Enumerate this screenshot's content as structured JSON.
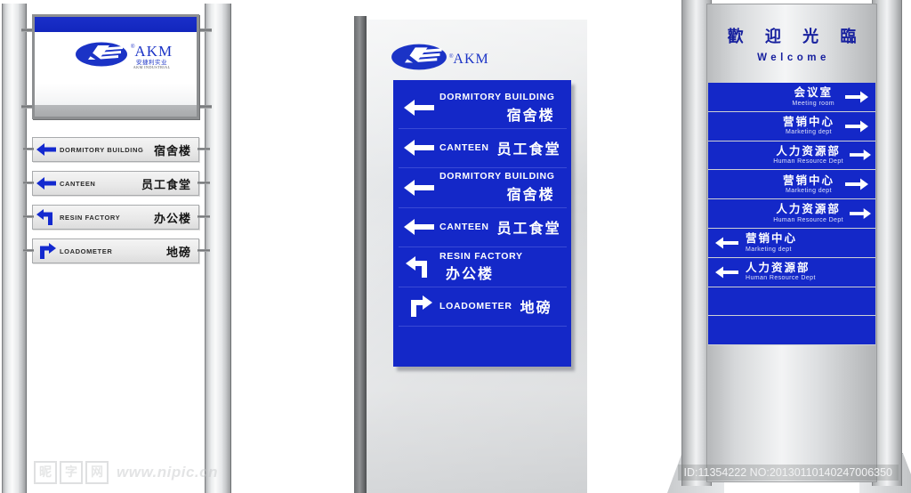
{
  "colors": {
    "sign_blue": "#1428c8",
    "logo_blue": "#1b33c6",
    "welcome_blue": "#17209e",
    "plate_grey": "#e9e9e9",
    "metal_light": "#f3f4f5"
  },
  "brand": {
    "name": "AKM",
    "registered": "®",
    "cn_name": "安捷利实业",
    "en_sub": "AKM INDUSTRIAL"
  },
  "left_pylon": {
    "name": "Left pylon sign with header billboard",
    "billboard": {
      "logo_name": "AKM"
    },
    "plates": [
      {
        "arrow": "arrow-left-icon",
        "en": "DORMITORY BUILDING",
        "cn": "宿舍楼"
      },
      {
        "arrow": "arrow-left-icon",
        "en": "CANTEEN",
        "cn": "员工食堂"
      },
      {
        "arrow": "arrow-left-up-icon",
        "en": "RESIN FACTORY",
        "cn": "办公楼"
      },
      {
        "arrow": "arrow-right-up-icon",
        "en": "LOADOMETER",
        "cn": "地磅"
      }
    ]
  },
  "mid_pylon": {
    "name": "Monolith pylon sign",
    "logo": "AKM",
    "rows": [
      {
        "arrow": "arrow-left-icon",
        "en": "DORMITORY BUILDING",
        "cn": "宿舍楼",
        "layout": "stack"
      },
      {
        "arrow": "arrow-left-icon",
        "en": "CANTEEN",
        "cn": "员工食堂",
        "layout": "inline"
      },
      {
        "arrow": "arrow-left-icon",
        "en": "DORMITORY BUILDING",
        "cn": "宿舍楼",
        "layout": "stack"
      },
      {
        "arrow": "arrow-left-icon",
        "en": "CANTEEN",
        "cn": "员工食堂",
        "layout": "inline"
      },
      {
        "arrow": "arrow-left-up-icon",
        "en": "RESIN FACTORY",
        "cn": "办公楼",
        "layout": "inline"
      },
      {
        "arrow": "arrow-right-up-icon",
        "en": "LOADOMETER",
        "cn": "地磅",
        "layout": "inline"
      },
      {
        "arrow": "",
        "en": "",
        "cn": "",
        "layout": "blank"
      }
    ]
  },
  "right_pylon": {
    "name": "Welcome directory pylon",
    "welcome_cn": "歡 迎 光 臨",
    "welcome_en": "Welcome",
    "rows": [
      {
        "cn": "会议室",
        "en": "Meeting room",
        "arrow": "arrow-right-icon",
        "dir": "right"
      },
      {
        "cn": "营销中心",
        "en": "Marketing dept",
        "arrow": "arrow-right-icon",
        "dir": "right"
      },
      {
        "cn": "人力资源部",
        "en": "Human Resource Dept",
        "arrow": "arrow-right-icon",
        "dir": "right"
      },
      {
        "cn": "营销中心",
        "en": "Marketing dept",
        "arrow": "arrow-right-icon",
        "dir": "right"
      },
      {
        "cn": "人力资源部",
        "en": "Human Resource Dept",
        "arrow": "arrow-right-icon",
        "dir": "right"
      },
      {
        "cn": "营销中心",
        "en": "Marketing dept",
        "arrow": "arrow-left-icon",
        "dir": "left"
      },
      {
        "cn": "人力资源部",
        "en": "Human Resource Dept",
        "arrow": "arrow-left-icon",
        "dir": "left"
      },
      {
        "cn": "",
        "en": "",
        "arrow": "",
        "dir": "blank"
      },
      {
        "cn": "",
        "en": "",
        "arrow": "",
        "dir": "blank"
      }
    ]
  },
  "watermark": {
    "blocks": [
      "昵",
      "字",
      "网"
    ],
    "url": "www.nipic.cn"
  },
  "footer": {
    "id_line": "ID:11354222 NO:20130110140247006350"
  }
}
